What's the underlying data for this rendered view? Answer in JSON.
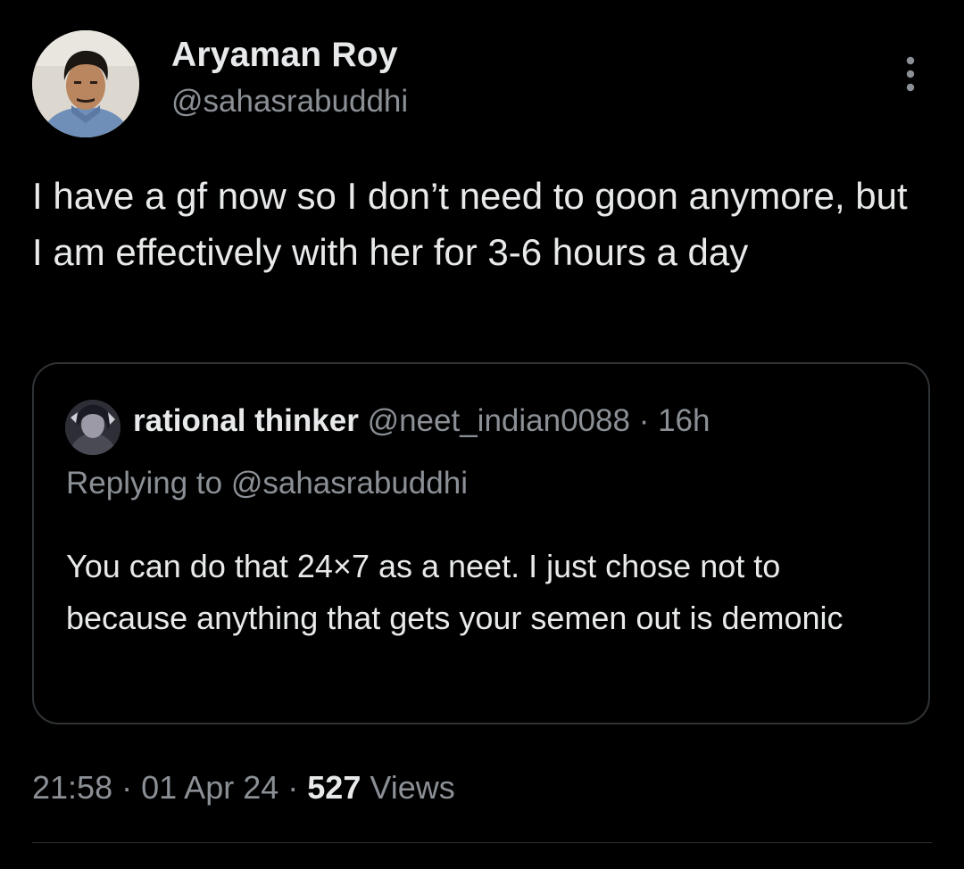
{
  "tweet": {
    "author_name": "Aryaman Roy",
    "author_handle": "@sahasrabuddhi",
    "avatar_icon": "user-avatar-photo",
    "more_icon": "more-options-vertical-icon",
    "text": "I have a gf now so I don’t need to goon anymore, but I am effectively with her for 3-6 hours a day",
    "time": "21:58",
    "date": "01 Apr 24",
    "separator": "·",
    "views_count": "527",
    "views_label": "Views"
  },
  "quote": {
    "author_name": "rational thinker",
    "author_handle": "@neet_indian0088",
    "separator": "·",
    "age": "16h",
    "avatar_icon": "anime-avatar-image",
    "replying_to": "Replying to @sahasrabuddhi",
    "text": "You can do that 24×7 as a neet. I just chose not to because anything that gets your semen out is demonic"
  },
  "colors": {
    "background": "#000000",
    "primary_text": "#e7e9ea",
    "secondary_text": "#8b9096",
    "border": "#2f3336"
  }
}
